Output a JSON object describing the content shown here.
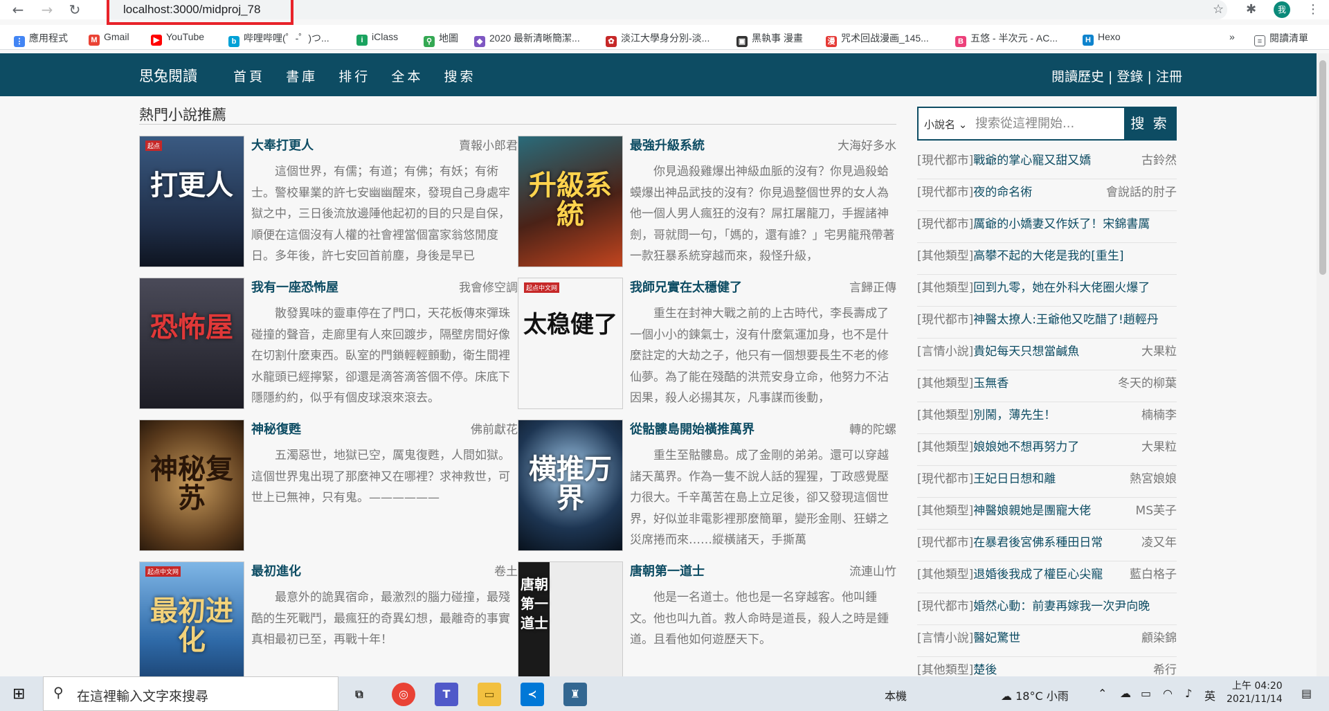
{
  "browser": {
    "url": "localhost:3000/midproj_78",
    "profile_initial": "我",
    "bookmarks": [
      {
        "label": "應用程式",
        "icon": "apps-grid-icon",
        "color": "#4285f4"
      },
      {
        "label": "Gmail",
        "icon": "gmail-icon",
        "color": "#ea4335"
      },
      {
        "label": "YouTube",
        "icon": "youtube-icon",
        "color": "#ff0000"
      },
      {
        "label": "哔哩哔哩(゜-゜)つ...",
        "icon": "bilibili-icon",
        "color": "#00a1d6"
      },
      {
        "label": "iClass",
        "icon": "iclass-icon",
        "color": "#1aa35f"
      },
      {
        "label": "地圖",
        "icon": "maps-pin-icon",
        "color": "#34a853"
      },
      {
        "label": "2020 最新清晰簡潔...",
        "icon": "bookmark-icon",
        "color": "#7e57c2"
      },
      {
        "label": "淡江大學身分別-淡...",
        "icon": "tku-icon",
        "color": "#c62828"
      },
      {
        "label": "黑執事 漫畫",
        "icon": "manga-icon",
        "color": "#333333"
      },
      {
        "label": "咒术回战漫画_145...",
        "icon": "manhua-icon",
        "color": "#e53935"
      },
      {
        "label": "五悠 - 半次元 - AC...",
        "icon": "bcy-icon",
        "color": "#ec407a"
      },
      {
        "label": "Hexo",
        "icon": "hexo-icon",
        "color": "#0e83cd"
      }
    ],
    "more_bookmarks": "»",
    "reading_list": "閱讀清單"
  },
  "site": {
    "brand": "思兔閱讀",
    "nav": [
      "首頁",
      "書庫",
      "排行",
      "全本",
      "搜索"
    ],
    "user_links": "閱讀歷史 | 登錄 | 注冊"
  },
  "hot": {
    "title": "熱門小說推薦",
    "books": [
      {
        "title": "大奉打更人",
        "author": "賣報小郎君",
        "cover_text": "打更人",
        "cover_color": "#223450",
        "desc": "這個世界，有儒；有道；有佛；有妖；有術士。警校畢業的許七安幽幽醒來，發現自己身處牢獄之中，三日後流放邊陲他起初的目的只是自保，順便在這個沒有人權的社會裡當個富家翁悠閒度日。多年後，許七安回首前塵，身後是早已"
      },
      {
        "title": "最強升級系統",
        "author": "大海好多水",
        "cover_text": "升級系統",
        "cover_color": "#5b2a1e",
        "desc": "你見過殺雞爆出神級血脈的沒有？你見過殺蛤蟆爆出神品武技的沒有？你見過整個世界的女人為他一個人男人瘋狂的沒有？屌扛屠龍刀，手握諸神劍，哥就問一句，「媽的，還有誰？」宅男龍飛帶著一款狂暴系統穿越而來，殺怪升級，"
      },
      {
        "title": "我有一座恐怖屋",
        "author": "我會修空調",
        "cover_text": "恐怖屋",
        "cover_color": "#2b2b35",
        "desc": "散發異味的靈車停在了門口，天花板傳來彈珠碰撞的聲音，走廊里有人來回踱步，隔壁房間好像在切割什麼東西。臥室的門鎖輕輕顫動，衛生間裡水龍頭已經擰緊，卻還是滴答滴答個不停。床底下隱隱約約，似乎有個皮球滾來滾去。"
      },
      {
        "title": "我師兄實在太穩健了",
        "author": "言歸正傳",
        "cover_text": "太稳健了",
        "cover_color": "#f4f4f4",
        "desc": "重生在封神大戰之前的上古時代，李長壽成了一個小小的鍊氣士，沒有什麼氣運加身，也不是什麼註定的大劫之子，他只有一個想要長生不老的修仙夢。為了能在殘酷的洪荒安身立命，他努力不沾因果，殺人必揚其灰，凡事謀而後動，"
      },
      {
        "title": "神秘復甦",
        "author": "佛前獻花",
        "cover_text": "神秘复苏",
        "cover_color": "#4a2d1a",
        "desc": "五濁惡世，地獄已空，厲鬼復甦，人間如獄。這個世界鬼出現了那麼神又在哪裡？求神救世，可世上已無神，只有鬼。——————"
      },
      {
        "title": "從骷髏島開始橫推萬界",
        "author": "轉的陀螺",
        "cover_text": "横推万界",
        "cover_color": "#16263a",
        "desc": "重生至骷髏島。成了金剛的弟弟。還可以穿越諸天萬界。作為一隻不說人話的猩猩，丁政感覺壓力很大。千辛萬苦在島上立足後，卻又發現這個世界，好似並非電影裡那麼簡單，變形金剛、狂蟒之災席捲而來……縱橫諸天，手撕萬"
      },
      {
        "title": "最初進化",
        "author": "卷土",
        "cover_text": "最初进化",
        "cover_color": "#2f6aa8",
        "desc": "最意外的詭異宿命，最激烈的腦力碰撞，最殘酷的生死戰鬥，最瘋狂的奇異幻想，最離奇的事實真相最初已至，再戰十年！"
      },
      {
        "title": "唐朝第一道士",
        "author": "流連山竹",
        "cover_text": "唐朝第一道士",
        "cover_color": "#1a1a1a",
        "desc": "他是一名道士。他也是一名穿越客。他叫鍾文。他也叫九首。救人命時是道長，殺人之時是鍾道。且看他如何遊歷天下。"
      }
    ]
  },
  "search": {
    "type": "小說名",
    "placeholder": "搜索從這裡開始...",
    "button": "搜 索"
  },
  "ranking": [
    {
      "cat": "[現代都市]",
      "name": "戰爺的掌心寵又甜又嬌",
      "author": "古鈴然"
    },
    {
      "cat": "[現代都市]",
      "name": "夜的命名術",
      "author": "會說話的肘子"
    },
    {
      "cat": "[現代都市]",
      "name": "厲爺的小嬌妻又作妖了！宋錦書厲",
      "author": ""
    },
    {
      "cat": "[其他類型]",
      "name": "高攀不起的大佬是我的[重生]",
      "author": ""
    },
    {
      "cat": "[其他類型]",
      "name": "回到九零，她在外科大佬圈火爆了",
      "author": ""
    },
    {
      "cat": "[現代都市]",
      "name": "神醫太撩人:王爺他又吃醋了!趙輕丹",
      "author": ""
    },
    {
      "cat": "[言情小說]",
      "name": "貴妃每天只想當鹹魚",
      "author": "大果粒"
    },
    {
      "cat": "[其他類型]",
      "name": "玉無香",
      "author": "冬天的柳葉"
    },
    {
      "cat": "[其他類型]",
      "name": "別鬧，薄先生！",
      "author": "楠楠李"
    },
    {
      "cat": "[其他類型]",
      "name": "娘娘她不想再努力了",
      "author": "大果粒"
    },
    {
      "cat": "[現代都市]",
      "name": "王妃日日想和離",
      "author": "熱宮娘娘"
    },
    {
      "cat": "[其他類型]",
      "name": "神醫娘親她是團寵大佬",
      "author": "MS芙子"
    },
    {
      "cat": "[現代都市]",
      "name": "在暴君後宮佛系種田日常",
      "author": "凌又年"
    },
    {
      "cat": "[其他類型]",
      "name": "退婚後我成了權臣心尖寵",
      "author": "藍白格子"
    },
    {
      "cat": "[現代都市]",
      "name": "婚然心動：前妻再嫁我一次尹向晚",
      "author": ""
    },
    {
      "cat": "[言情小說]",
      "name": "醫妃驚世",
      "author": "顧染錦"
    },
    {
      "cat": "[其他類型]",
      "name": "楚後",
      "author": "希行"
    }
  ],
  "taskbar": {
    "search_placeholder": "在這裡輸入文字來搜尋",
    "location": "本機",
    "weather": "18°C 小雨",
    "ime": "英",
    "time": "上午 04:20",
    "date": "2021/11/14"
  }
}
